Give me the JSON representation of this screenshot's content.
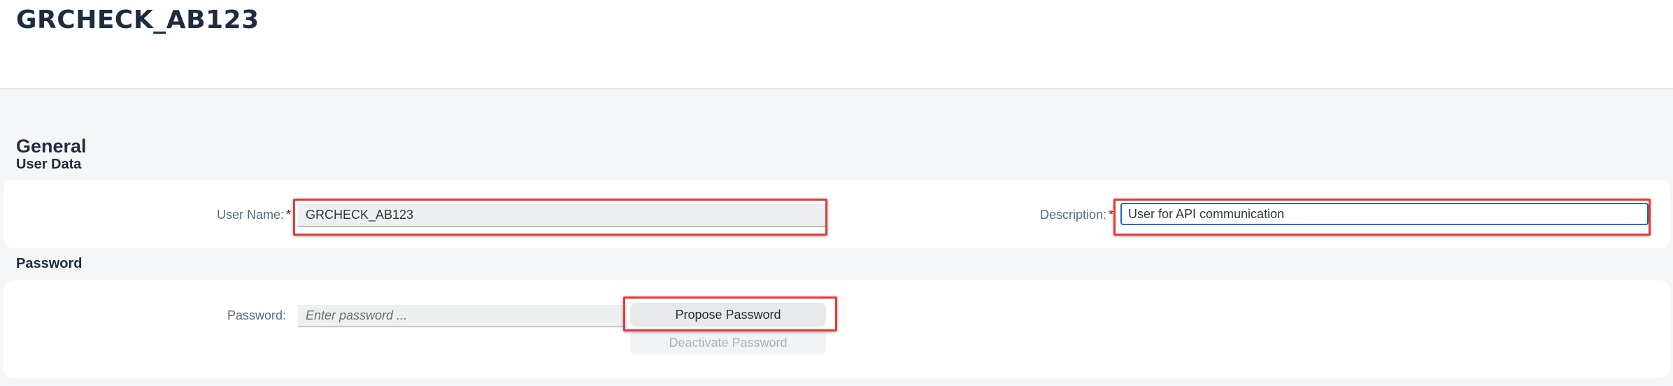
{
  "header": {
    "title": "GRCHECK_AB123"
  },
  "section": {
    "title": "General"
  },
  "user_data": {
    "title": "User Data",
    "user_name_label": "User Name:",
    "user_name_value": "GRCHECK_AB123",
    "description_label": "Description:",
    "description_value": "User for API communication",
    "required_marker": "*"
  },
  "password": {
    "title": "Password",
    "label": "Password:",
    "placeholder": "Enter password ...",
    "propose_button": "Propose Password",
    "deactivate_button": "Deactivate Password"
  },
  "highlight_color": "#e53935",
  "accent_color": "#0a6ed1"
}
